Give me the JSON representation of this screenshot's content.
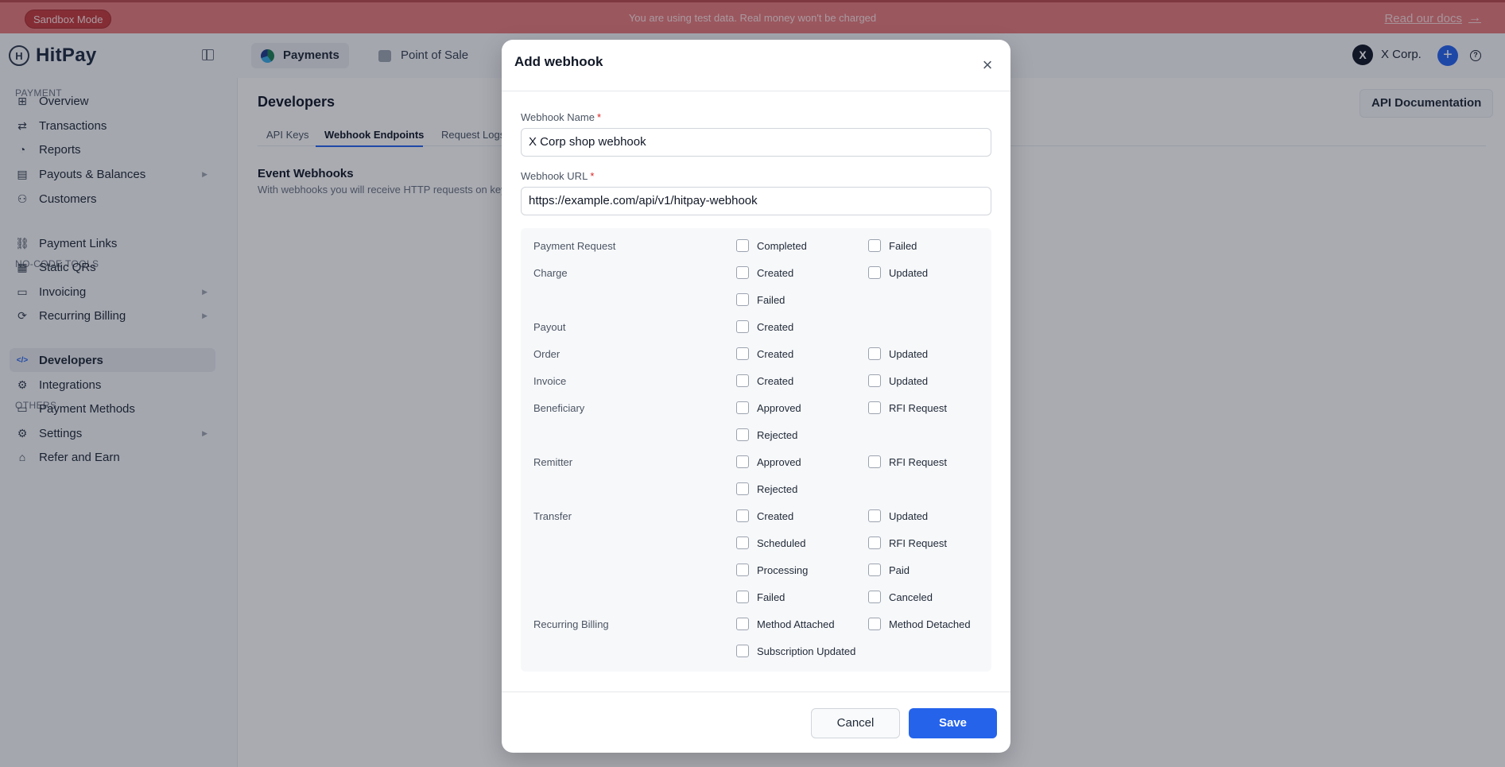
{
  "banner": {
    "mode_label": "Sandbox Mode",
    "message": "You are using test data. Real money won't be charged",
    "docs_link": "Read our docs",
    "docs_arrow": "→"
  },
  "sidebar": {
    "brand": "HitPay",
    "logo_letter": "H",
    "sections": {
      "payment": "PAYMENT",
      "no_code": "NO-CODE TOOLS",
      "others": "OTHERS"
    },
    "items": [
      {
        "label": "Overview",
        "icon": "⊞"
      },
      {
        "label": "Transactions",
        "icon": "⇄"
      },
      {
        "label": "Reports",
        "icon": "◔"
      },
      {
        "label": "Payouts & Balances",
        "icon": "▤",
        "caret": "▶"
      },
      {
        "label": "Customers",
        "icon": "⚇"
      },
      {
        "label": "Payment Links",
        "icon": "⛓"
      },
      {
        "label": "Static QRs",
        "icon": "▦"
      },
      {
        "label": "Invoicing",
        "icon": "▭",
        "caret": "▶"
      },
      {
        "label": "Recurring Billing",
        "icon": "⟳",
        "caret": "▶"
      },
      {
        "label": "Developers",
        "icon": "</>"
      },
      {
        "label": "Integrations",
        "icon": "⚙"
      },
      {
        "label": "Payment Methods",
        "icon": "▭"
      },
      {
        "label": "Settings",
        "icon": "⚙",
        "caret": "▶"
      },
      {
        "label": "Refer and Earn",
        "icon": "⌂"
      }
    ]
  },
  "topnav": {
    "payments": "Payments",
    "pos": "Point of Sale",
    "avatar_letter": "X",
    "account": "X Corp.",
    "plus": "+",
    "help": "?"
  },
  "content": {
    "title": "Developers",
    "api_doc_button": "API Documentation",
    "tabs": [
      "API Keys",
      "Webhook Endpoints",
      "Request Logs"
    ],
    "event_title": "Event Webhooks",
    "event_subtitle": "With webhooks you will receive HTTP requests on key"
  },
  "modal": {
    "title": "Add webhook",
    "close": "×",
    "name_label": "Webhook Name",
    "name_value": "X Corp shop webhook",
    "url_label": "Webhook URL",
    "url_value": "https://example.com/api/v1/hitpay-webhook",
    "required_mark": "*",
    "events": [
      {
        "group": "Payment Request",
        "options": [
          "Completed",
          "Failed"
        ]
      },
      {
        "group": "Charge",
        "options": [
          "Created",
          "Updated",
          "Failed"
        ]
      },
      {
        "group": "Payout",
        "options": [
          "Created"
        ]
      },
      {
        "group": "Order",
        "options": [
          "Created",
          "Updated"
        ]
      },
      {
        "group": "Invoice",
        "options": [
          "Created",
          "Updated"
        ]
      },
      {
        "group": "Beneficiary",
        "options": [
          "Approved",
          "RFI Request",
          "Rejected"
        ]
      },
      {
        "group": "Remitter",
        "options": [
          "Approved",
          "RFI Request",
          "Rejected"
        ]
      },
      {
        "group": "Transfer",
        "options": [
          "Created",
          "Updated",
          "Scheduled",
          "RFI Request",
          "Processing",
          "Paid",
          "Failed",
          "Canceled"
        ]
      },
      {
        "group": "Recurring Billing",
        "options": [
          "Method Attached",
          "Method Detached",
          "Subscription Updated"
        ]
      }
    ],
    "cancel": "Cancel",
    "save": "Save"
  }
}
